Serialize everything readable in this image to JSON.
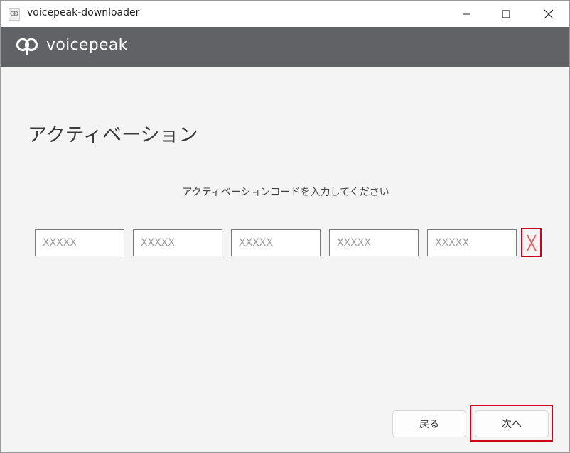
{
  "window": {
    "title": "voicepeak-downloader"
  },
  "header": {
    "brand": "voicepeak"
  },
  "page": {
    "title": "アクティベーション",
    "instruction": "アクティベーションコードを入力してください"
  },
  "code_fields": [
    {
      "value": "",
      "placeholder": "XXXXX"
    },
    {
      "value": "",
      "placeholder": "XXXXX"
    },
    {
      "value": "",
      "placeholder": "XXXXX"
    },
    {
      "value": "",
      "placeholder": "XXXXX"
    },
    {
      "value": "",
      "placeholder": "XXXXX"
    }
  ],
  "clear_label": "X",
  "buttons": {
    "back": "戻る",
    "next": "次へ"
  },
  "colors": {
    "header": "#616266",
    "highlight": "#d0021b",
    "clear": "#e0646d"
  }
}
